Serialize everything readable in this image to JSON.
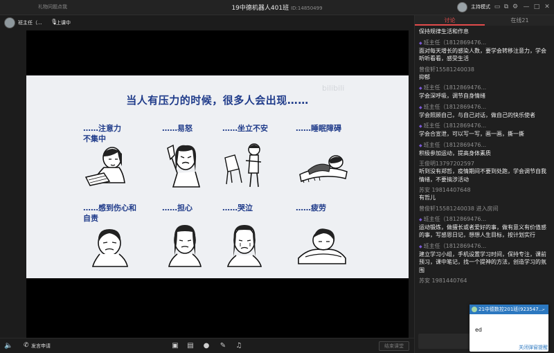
{
  "topbar": {
    "left_link": "礼物问题点我",
    "title": "19中德机器人401班",
    "room_id": "ID:14850499",
    "host_mode": "主持模式"
  },
  "userstrip": {
    "user_name": "班主任（...",
    "status": "上课中"
  },
  "slide": {
    "heading": "当人有压力的时候，很多人会出现……",
    "watermark": "bilibili",
    "items": [
      {
        "label": "……注意力不集中"
      },
      {
        "label": "……易怒"
      },
      {
        "label": "……坐立不安"
      },
      {
        "label": "……睡眠障碍"
      },
      {
        "label": "……感到伤心和自责"
      },
      {
        "label": "……担心"
      },
      {
        "label": "……哭泣"
      },
      {
        "label": "……疲劳"
      }
    ]
  },
  "bottombar": {
    "speak": "发言申请",
    "end_class": "结束课堂"
  },
  "panel": {
    "tab_discuss": "讨论",
    "tab_online": "在线21"
  },
  "chat": [
    {
      "sender": "",
      "text": "保持规律生活和作息"
    },
    {
      "sender": "班主任（1812869476...",
      "badge": true,
      "text": "面对每天增长的感染人数，要学会转移注意力，学会听听看看，感受生活"
    },
    {
      "sender": "曾俊轩15581240038",
      "text": "抑郁"
    },
    {
      "sender": "班主任（1812869476...",
      "badge": true,
      "text": "学会深呼吸，调节自身情绪"
    },
    {
      "sender": "班主任（1812869476...",
      "badge": true,
      "text": "学会照顾自己，与自己对话，做自己的快乐使者"
    },
    {
      "sender": "班主任（1812869476...",
      "badge": true,
      "text": "学会合宣泄，可以写一写，画一画，撕一撕"
    },
    {
      "sender": "班主任（1812869476...",
      "badge": true,
      "text": "积极参加运动，提高身体素质"
    },
    {
      "sender": "王俊明13797202597",
      "text": "听到没有郑哲，疫情期间不要到处跑，学会调节自我情绪，不要搞涉活动"
    },
    {
      "sender": "苏安 19814407648",
      "text": "有哲儿"
    },
    {
      "sender": "曾俊轩15581240038 进入房间",
      "text": ""
    },
    {
      "sender": "班主任（1812869476...",
      "badge": true,
      "text": "运动锻炼，做擅长或者爱好的事，做有意义有价值感的事，写感恩日记，想想人生目标，按计划实行"
    },
    {
      "sender": "班主任（1812869476...",
      "badge": true,
      "text": "建立学习小组，手机设置学习时间，保持专注，课前预习，课中笔记，找一个提神的方法，创造学习的氛围"
    },
    {
      "sender": "苏安 1981440764",
      "text": ""
    }
  ],
  "popup": {
    "header": "21中德数控201班(923547...",
    "message": "ed",
    "close_label": "关闭弹窗提醒"
  }
}
